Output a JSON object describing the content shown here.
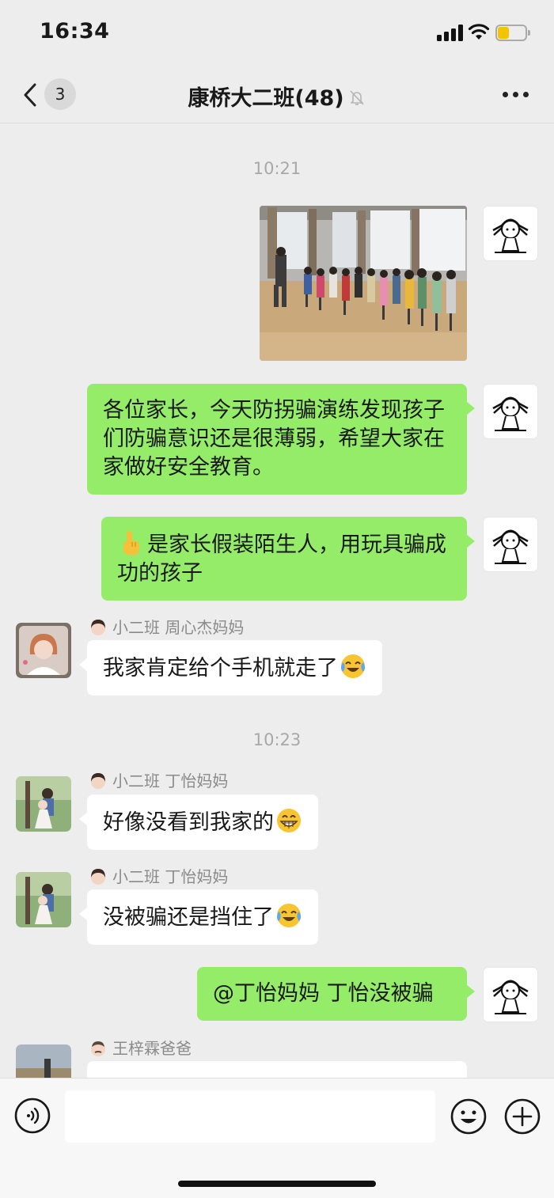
{
  "status": {
    "time": "16:34"
  },
  "nav": {
    "unread": "3",
    "title": "康桥大二班(48)"
  },
  "chat": {
    "time1": "10:21",
    "msg_text": "各位家长，今天防拐骗演练发现孩子们防骗意识还是很薄弱，希望大家在家做好安全教育。",
    "msg_point": "是家长假装陌生人，用玩具骗成功的孩子",
    "sender1": "小二班 周心杰妈妈",
    "msg_phone": "我家肯定给个手机就走了",
    "time2": "10:23",
    "sender2": "小二班 丁怡妈妈",
    "msg_notseen": "好像没看到我家的",
    "sender3": "小二班 丁怡妈妈",
    "msg_blocked": "没被骗还是挡住了",
    "msg_reply": "@丁怡妈妈 丁怡没被骗",
    "sender4": "王梓霖爸爸"
  },
  "emoji_names": [
    "pointing-up-emoji",
    "crying-laughing-emoji",
    "grinning-emoji"
  ],
  "colors": {
    "self_bubble": "#95ec69",
    "other_bubble": "#ffffff",
    "background": "#ededed"
  }
}
